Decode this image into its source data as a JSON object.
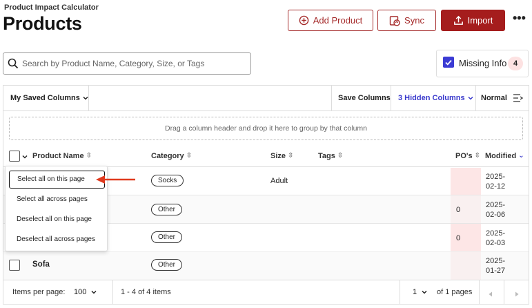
{
  "app_title": "Product Impact Calculator",
  "page_title": "Products",
  "actions": {
    "add": "Add Product",
    "sync": "Sync",
    "import": "Import",
    "more": "•••"
  },
  "search": {
    "placeholder": "Search by Product Name, Category, Size, or Tags",
    "value": ""
  },
  "missing_info": {
    "label": "Missing Info",
    "count": "4",
    "checked": true
  },
  "toolbar": {
    "saved_columns": "My Saved Columns",
    "save_columns": "Save Columns",
    "hidden_columns": "3 Hidden Columns",
    "density": "Normal"
  },
  "group_zone": "Drag a column header and drop it here to group by that column",
  "columns": {
    "product_name": "Product Name",
    "category": "Category",
    "size": "Size",
    "tags": "Tags",
    "pos": "PO's",
    "modified": "Modified"
  },
  "rows": [
    {
      "name": "",
      "category": "Socks",
      "size": "Adult",
      "tags": "",
      "pos": "",
      "modified": "2025-02-12"
    },
    {
      "name": "",
      "category": "Other",
      "size": "",
      "tags": "",
      "pos": "0",
      "modified": "2025-02-06"
    },
    {
      "name": "",
      "category": "Other",
      "size": "",
      "tags": "",
      "pos": "0",
      "modified": "2025-02-03"
    },
    {
      "name": "Sofa",
      "category": "Other",
      "size": "",
      "tags": "",
      "pos": "",
      "modified": "2025-01-27"
    }
  ],
  "select_menu": [
    "Select all on this page",
    "Select all across pages",
    "Deselect all on this page",
    "Deselect all across pages"
  ],
  "footer": {
    "items_per_page_label": "Items per page:",
    "items_per_page": "100",
    "range": "1 - 4 of 4 items",
    "page": "1",
    "of_pages": "of 1 pages"
  },
  "colors": {
    "brand_red": "#a51d1d",
    "accent_blue": "#3b3bd4",
    "po_highlight": "#fde6e6",
    "arrow": "#e03a1e"
  }
}
